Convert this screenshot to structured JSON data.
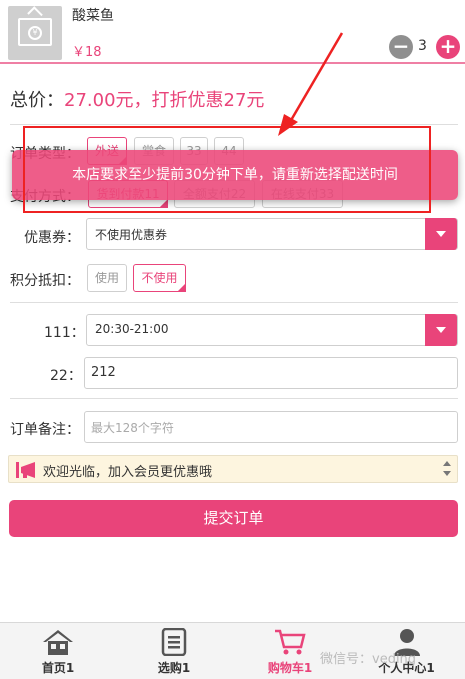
{
  "product": {
    "name": "酸菜鱼",
    "price": "￥18",
    "quantity": "3",
    "minus": "−",
    "plus": "+"
  },
  "total": {
    "label": "总价：",
    "value": "27.00元，打折优惠27元"
  },
  "order_type": {
    "label": "订单类型：",
    "options": [
      "外送",
      "堂食",
      "33",
      "44"
    ],
    "selected": "外送"
  },
  "payment": {
    "label": "支付方式：",
    "options": [
      "货到付款11",
      "全额支付22",
      "在线支付33"
    ],
    "selected": "货到付款11"
  },
  "coupon": {
    "label": "优惠券：",
    "value": "不使用优惠券"
  },
  "points": {
    "label": "积分抵扣：",
    "options": [
      "使用",
      "不使用"
    ],
    "selected": "不使用"
  },
  "field111": {
    "label": "111：",
    "value": "20:30-21:00"
  },
  "field22": {
    "label": "22：",
    "value": "212"
  },
  "remark": {
    "label": "订单备注：",
    "placeholder": "最大128个字符"
  },
  "notice": {
    "text": "欢迎光临，加入会员更优惠哦"
  },
  "submit": {
    "label": "提交订单"
  },
  "toast": {
    "text": "本店要求至少提前30分钟下单，请重新选择配送时间"
  },
  "nav": [
    {
      "label": "首页1",
      "icon": "home-icon"
    },
    {
      "label": "选购1",
      "icon": "list-icon"
    },
    {
      "label": "购物车1",
      "icon": "cart-icon"
    },
    {
      "label": "个人中心1",
      "icon": "user-icon"
    }
  ],
  "nav_active": "购物车1",
  "watermark": "微信号：veding",
  "colors": {
    "accent": "#e9447a",
    "toast": "#ec4779",
    "annotation": "#ee2222",
    "notice_bg": "#fdf5df"
  }
}
